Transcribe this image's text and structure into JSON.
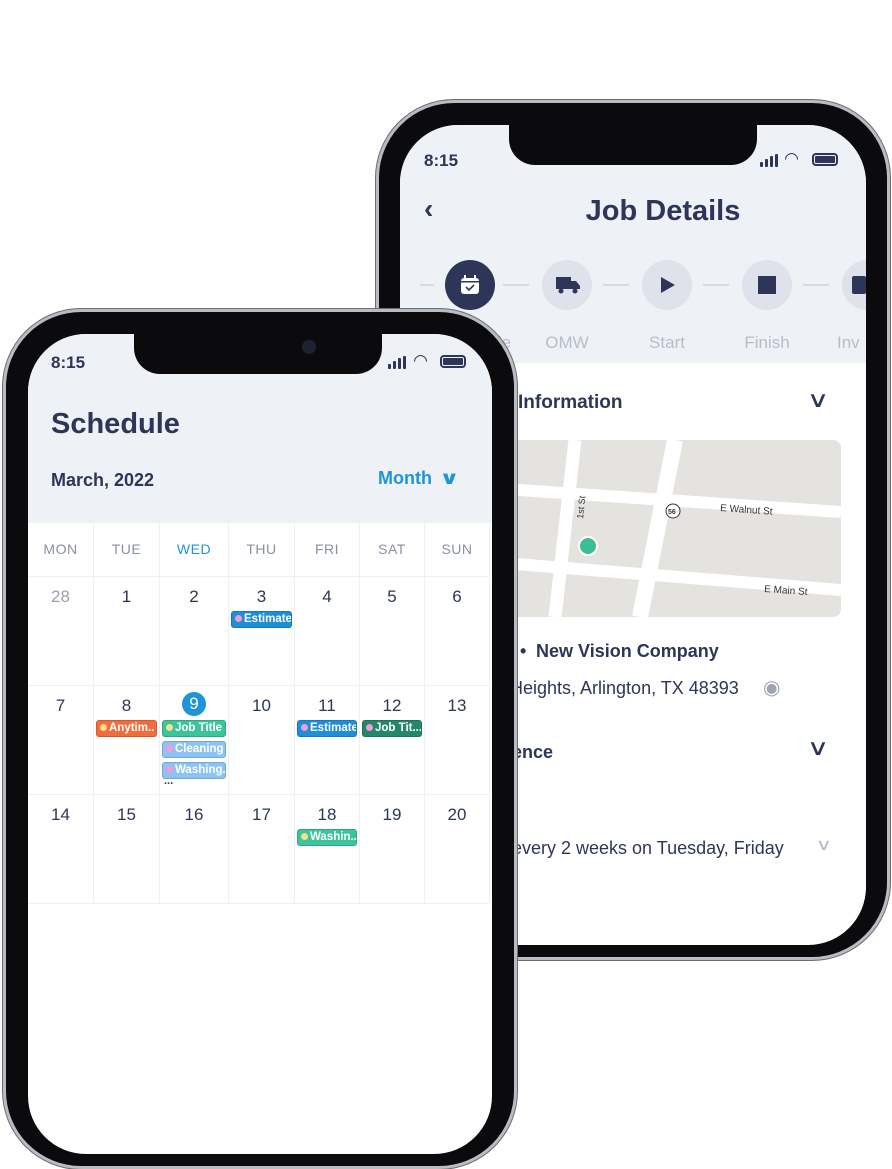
{
  "colors": {
    "navy": "#2d3658",
    "accent": "#1e95d8",
    "header_bg": "#eef1f6",
    "estimate": "#1e8fd6",
    "job_title": "#3cc59a",
    "job_title_dark": "#25876a",
    "cleaning": "#8cc3f5",
    "anytime": "#f26d3d",
    "dot_pink": "#f59ad7",
    "dot_yellow": "#f7e08a"
  },
  "back_phone": {
    "time": "8:15",
    "title": "Job Details",
    "back_icon": "chevron-left-icon",
    "steps": [
      {
        "label": "le",
        "icon": "calendar-check-icon",
        "active": true
      },
      {
        "label": "OMW",
        "icon": "truck-icon",
        "active": false
      },
      {
        "label": "Start",
        "icon": "play-icon",
        "active": false
      },
      {
        "label": "Finish",
        "icon": "stop-icon",
        "active": false
      },
      {
        "label": "Inv",
        "icon": "invoice-icon",
        "active": false
      }
    ],
    "info_section": "Information",
    "map": {
      "streets": [
        "1st St",
        "E Walnut St",
        "E Main St"
      ],
      "route_badge": "56"
    },
    "company": "New Vision Company",
    "address": "Heights, Arlington, TX 48393",
    "recurrence_section": "ence",
    "recurrence_value": "every 2 weeks on Tuesday, Friday"
  },
  "front_phone": {
    "time": "8:15",
    "title": "Schedule",
    "month": "March, 2022",
    "view_selector": "Month",
    "weekdays": [
      "MON",
      "TUE",
      "WED",
      "THU",
      "FRI",
      "SAT",
      "SUN"
    ],
    "today_index": 2,
    "weeks": [
      [
        {
          "day": "28",
          "muted": true,
          "events": []
        },
        {
          "day": "1",
          "events": []
        },
        {
          "day": "2",
          "events": []
        },
        {
          "day": "3",
          "events": [
            {
              "label": "Estimate",
              "type": "estimate",
              "dot": "pink"
            }
          ]
        },
        {
          "day": "4",
          "events": []
        },
        {
          "day": "5",
          "events": []
        },
        {
          "day": "6",
          "events": []
        }
      ],
      [
        {
          "day": "7",
          "events": []
        },
        {
          "day": "8",
          "events": [
            {
              "label": "Anytim..",
              "type": "anytime",
              "dot": "yellow"
            }
          ]
        },
        {
          "day": "9",
          "today": true,
          "more": "...",
          "events": [
            {
              "label": "Job Title",
              "type": "job_title",
              "dot": "yellow"
            },
            {
              "label": "Cleaning",
              "type": "cleaning",
              "dot": "pink"
            },
            {
              "label": "Washing..",
              "type": "cleaning",
              "dot": "pink"
            }
          ]
        },
        {
          "day": "10",
          "events": []
        },
        {
          "day": "11",
          "events": [
            {
              "label": "Estimate",
              "type": "estimate",
              "dot": "pink"
            }
          ]
        },
        {
          "day": "12",
          "events": [
            {
              "label": "Job Tit...",
              "type": "job_title_dark",
              "dot": "pink"
            }
          ]
        },
        {
          "day": "13",
          "events": []
        }
      ],
      [
        {
          "day": "14",
          "events": []
        },
        {
          "day": "15",
          "events": []
        },
        {
          "day": "16",
          "events": []
        },
        {
          "day": "17",
          "events": []
        },
        {
          "day": "18",
          "events": [
            {
              "label": "Washin..",
              "type": "job_title",
              "dot": "yellow"
            }
          ]
        },
        {
          "day": "19",
          "events": []
        },
        {
          "day": "20",
          "events": []
        }
      ]
    ]
  }
}
